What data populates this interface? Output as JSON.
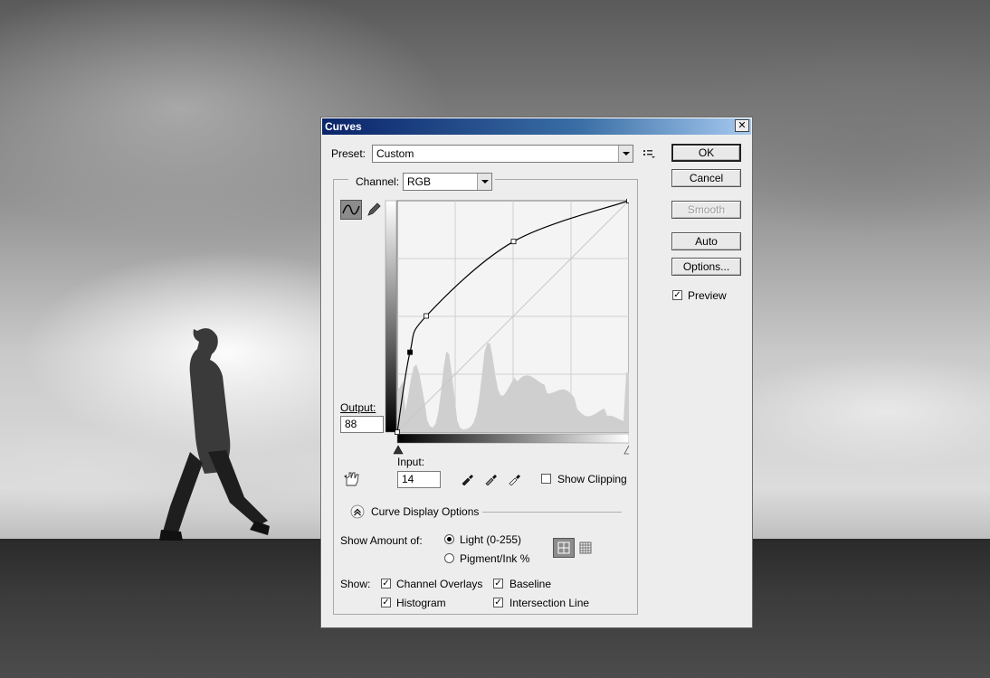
{
  "dialog": {
    "title": "Curves",
    "close_glyph": "✕",
    "preset": {
      "label": "Preset:",
      "value": "Custom"
    },
    "channel": {
      "label": "Channel:",
      "value": "RGB"
    },
    "output": {
      "label": "Output:",
      "value": "88"
    },
    "input": {
      "label": "Input:",
      "value": "14"
    },
    "show_clipping_label": "Show Clipping",
    "curve_display_options_label": "Curve Display Options",
    "show_amount_of": {
      "label": "Show Amount of:",
      "options": [
        "Light  (0-255)",
        "Pigment/Ink %"
      ],
      "selected": "Light  (0-255)"
    },
    "show": {
      "label": "Show:",
      "channel_overlays": "Channel Overlays",
      "baseline": "Baseline",
      "histogram": "Histogram",
      "intersection_line": "Intersection Line"
    },
    "buttons": {
      "ok": "OK",
      "cancel": "Cancel",
      "smooth": "Smooth",
      "auto": "Auto",
      "options": "Options..."
    },
    "preview_label": "Preview",
    "check_glyph": "✓",
    "curve": {
      "points": [
        [
          0,
          0
        ],
        [
          14,
          88
        ],
        [
          32,
          128
        ],
        [
          128,
          210
        ],
        [
          255,
          255
        ]
      ],
      "selected_point_index": 1
    },
    "icons": {
      "curve_tool": "curve-point-icon",
      "pencil_tool": "pencil-icon",
      "hand_tool": "on-image-adjust-icon",
      "eyedroppers": [
        "black-point-eyedropper-icon",
        "gray-point-eyedropper-icon",
        "white-point-eyedropper-icon"
      ],
      "grid_options": [
        "grid-4-icon",
        "grid-10-icon"
      ],
      "preset_menu": "preset-options-icon",
      "expand": "chevron-up-icon"
    }
  }
}
